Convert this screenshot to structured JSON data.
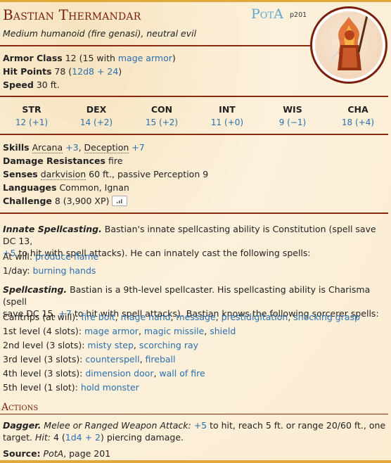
{
  "name": "Bastian Thermandar",
  "source_abbr": "PotA",
  "source_page": "p201",
  "subtitle": "Medium humanoid (fire genasi), neutral evil",
  "portrait_icon": "fire-genasi-portrait",
  "armor_class": {
    "label": "Armor Class",
    "value_pre": "12 (15 with ",
    "link": "mage armor",
    "value_post": ")"
  },
  "hit_points": {
    "label": "Hit Points",
    "value_pre": "78 (",
    "link": "12d8 + 24",
    "value_post": ")"
  },
  "speed": {
    "label": "Speed",
    "value": "30 ft."
  },
  "abilities": [
    {
      "label": "STR",
      "value": "12 (+1)"
    },
    {
      "label": "DEX",
      "value": "14 (+2)"
    },
    {
      "label": "CON",
      "value": "15 (+2)"
    },
    {
      "label": "INT",
      "value": "11 (+0)"
    },
    {
      "label": "WIS",
      "value": "9 (−1)"
    },
    {
      "label": "CHA",
      "value": "18 (+4)"
    }
  ],
  "skills": {
    "label": "Skills",
    "arcana": "Arcana",
    "arcana_bonus": "+3",
    "sep": ",",
    "deception": "Deception",
    "deception_bonus": "+7"
  },
  "damage_resistances": {
    "label": "Damage Resistances",
    "value": "fire"
  },
  "senses": {
    "label": "Senses",
    "darkvision": "darkvision",
    "value": " 60 ft., passive Perception 9"
  },
  "languages": {
    "label": "Languages",
    "value": "Common, Ignan"
  },
  "challenge": {
    "label": "Challenge",
    "value": "8 (3,900 XP)",
    "icon": "signal-bars-icon"
  },
  "innate": {
    "title": "Innate Spellcasting.",
    "text1": " Bastian's innate spellcasting ability is Constitution (spell save DC 13,",
    "bonus": "+5",
    "text2": " to hit with spell attacks). He can innately cast the following spells:",
    "at_will_label": "At will: ",
    "at_will_spell": "produce flame",
    "day_label": "1/day: ",
    "day_spell": "burning hands"
  },
  "spellcasting": {
    "title": "Spellcasting.",
    "text1": " Bastian is a 9th-level spellcaster. His spellcasting ability is Charisma (spell",
    "text2a": "save DC 15, ",
    "bonus": "+7",
    "text2b": " to hit with spell attacks). Bastian knows the following sorcerer spells:",
    "levels": [
      {
        "label": "Cantrips (at will): ",
        "spells": [
          "fire bolt",
          "mage hand",
          "message",
          "prestidigitation",
          "shocking grasp"
        ]
      },
      {
        "label": "1st level (4 slots): ",
        "spells": [
          "mage armor",
          "magic missile",
          "shield"
        ]
      },
      {
        "label": "2nd level (3 slots): ",
        "spells": [
          "misty step",
          "scorching ray"
        ]
      },
      {
        "label": "3rd level (3 slots): ",
        "spells": [
          "counterspell",
          "fireball"
        ]
      },
      {
        "label": "4th level (3 slots): ",
        "spells": [
          "dimension door",
          "wall of fire"
        ]
      },
      {
        "label": "5th level (1 slot): ",
        "spells": [
          "hold monster"
        ]
      }
    ]
  },
  "actions_header": "Actions",
  "dagger": {
    "title": "Dagger.",
    "type": " Melee or Ranged Weapon Attack:",
    "bonus": "+5",
    "text1": " to hit, reach 5 ft. or range 20/60 ft., one",
    "text2a": "target. ",
    "hit_label": "Hit:",
    "text2b": " 4 (",
    "dmg": "1d4 + 2",
    "text2c": ") piercing damage."
  },
  "source": {
    "label": "Source:",
    "book": "PotA",
    "page": ", page 201"
  },
  "colors": {
    "accent": "#7a200d",
    "link": "#2a6fb0",
    "bar": "#e0a93a",
    "source_abbr": "#5fa8d3"
  }
}
